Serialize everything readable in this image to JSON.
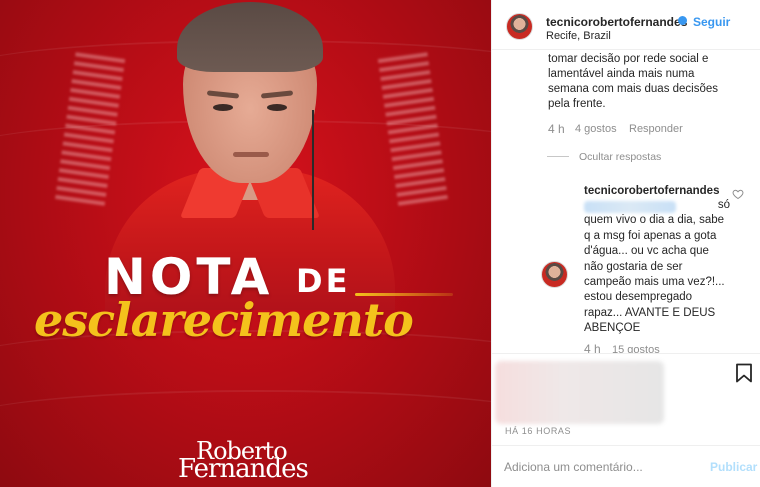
{
  "post_image": {
    "headline_word_1": "NOTA",
    "headline_word_2": "DE",
    "headline_word_3": "esclarecimento",
    "brand_line_1": "Roberto",
    "brand_line_2": "Fernandes",
    "colors": {
      "background": "#c41016",
      "accent_gold": "#f4c21c",
      "text": "#ffffff"
    }
  },
  "header": {
    "username": "tecnicorobertofernandes",
    "verified_icon": "verified-badge-icon",
    "separator": "•",
    "follow_label": "Seguir",
    "location": "Recife, Brazil"
  },
  "comments": {
    "first": {
      "text_lines": [
        "tomar decisão por rede social e",
        "lamentável ainda mais numa",
        "semana com mais duas decisões",
        "pela frente."
      ],
      "time": "4 h",
      "likes": "4 gostos",
      "reply_label": "Responder"
    },
    "hide_replies_label": "Ocultar respostas",
    "reply": {
      "username": "tecnicorobertofernandes",
      "text_first": "só",
      "text_rest": "quem vivo o dia a dia, sabe q a msg foi apenas a gota d'água... ou vc acha que não gostaria de ser campeão mais uma vez?!... estou desempregado rapaz... AVANTE E DEUS ABENÇOE",
      "time": "4 h",
      "likes": "15 gostos"
    }
  },
  "footer": {
    "post_time": "HÁ 16 HORAS",
    "comment_placeholder": "Adiciona um comentário...",
    "publish_label": "Publicar"
  },
  "colors": {
    "link_blue": "#3897f0",
    "muted": "#8e8e8e",
    "border": "#efefef"
  }
}
